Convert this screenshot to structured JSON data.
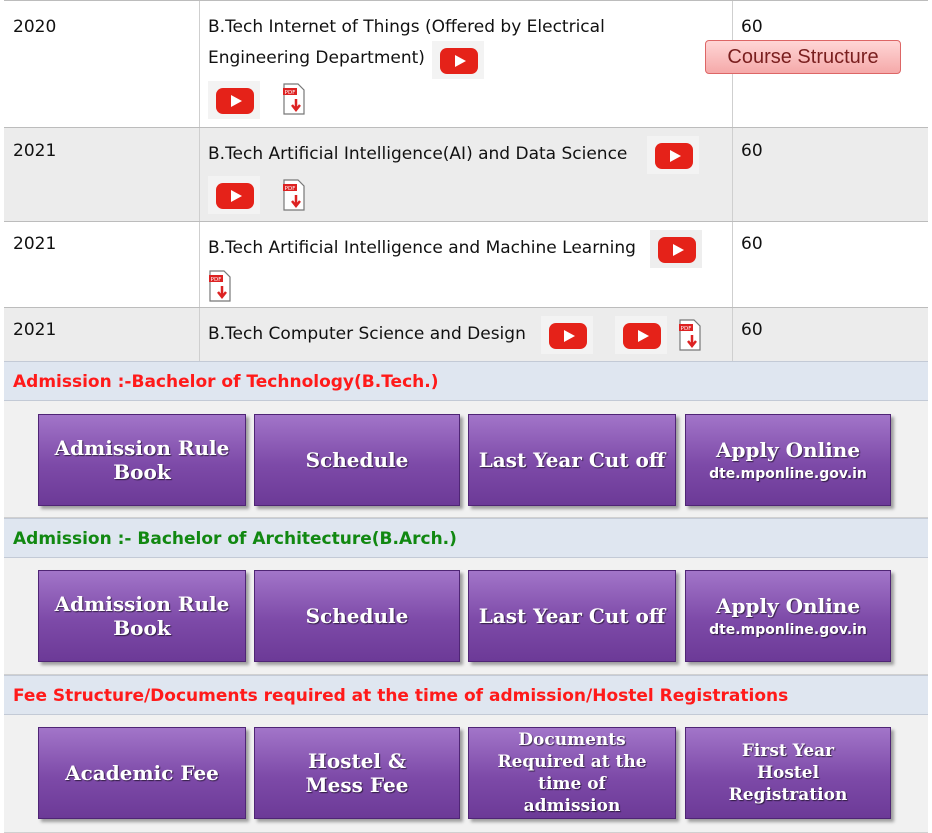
{
  "programs": [
    {
      "year": "2020",
      "line1": "B.Tech Internet of Things (Offered by Electrical",
      "line2": "Engineering Department)",
      "course_structure": "Course Structure",
      "intake": "60"
    },
    {
      "year": "2021",
      "line1": "B.Tech Artificial Intelligence(AI) and Data Science",
      "intake": "60"
    },
    {
      "year": "2021",
      "line1": "B.Tech Artificial Intelligence and Machine Learning",
      "intake": "60"
    },
    {
      "year": "2021",
      "line1": "B.Tech Computer Science and Design",
      "intake": "60"
    }
  ],
  "btech": {
    "title": "Admission :-Bachelor of Technology(B.Tech.)",
    "title_color": "#ff1a1a",
    "buttons": [
      {
        "label": "Admission Rule Book"
      },
      {
        "label": "Schedule"
      },
      {
        "label": "Last Year Cut off"
      },
      {
        "label": "Apply Online",
        "sub": "dte.mponline.gov.in"
      }
    ]
  },
  "barch": {
    "title": "Admission :- Bachelor of Architecture(B.Arch.)",
    "title_color": "#118811",
    "buttons": [
      {
        "label": "Admission Rule Book"
      },
      {
        "label": "Schedule"
      },
      {
        "label": "Last Year Cut off"
      },
      {
        "label": "Apply Online",
        "sub": "dte.mponline.gov.in"
      }
    ]
  },
  "fees": {
    "title": "Fee Structure/Documents required at the time of admission/Hostel Registrations",
    "title_color": "#ff1a1a",
    "buttons": [
      {
        "label": "Academic Fee"
      },
      {
        "label": "Hostel & Mess Fee"
      },
      {
        "label": "Documents Required at the time of admission"
      },
      {
        "label": "First Year Hostel Registration"
      }
    ]
  },
  "icons": {
    "video": "youtube-icon",
    "pdf": "pdf-download-icon"
  },
  "colors": {
    "button_purple": "#7d4aa8",
    "section_bg": "#dfe6f0",
    "youtube_red": "#e52219"
  }
}
